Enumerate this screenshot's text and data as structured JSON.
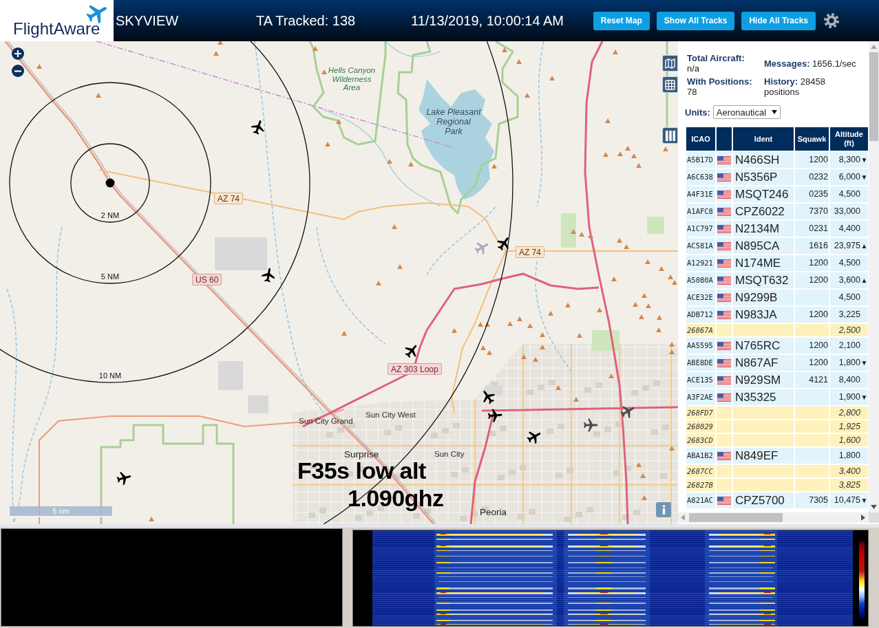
{
  "header": {
    "logo": "FlightAware",
    "title": "SKYVIEW",
    "tracked": "TA Tracked: 138",
    "datetime": "11/13/2019, 10:00:14 AM",
    "buttons": [
      "Reset Map",
      "Show All Tracks",
      "Hide All Tracks"
    ]
  },
  "map": {
    "areas": [
      {
        "kind": "wilderness",
        "lines": [
          "Hells Canyon",
          "Wilderness",
          "Area"
        ]
      },
      {
        "kind": "park",
        "lines": [
          "Lake Pleasant",
          "Regional",
          "Park"
        ]
      }
    ],
    "shields": [
      {
        "kind": "state",
        "text": "AZ 74"
      },
      {
        "kind": "state",
        "text": "AZ 74"
      },
      {
        "kind": "us",
        "text": "US 60"
      },
      {
        "kind": "us",
        "text": "AZ 303 Loop"
      }
    ],
    "places": [
      {
        "kind": "town",
        "text": "Sun City West"
      },
      {
        "kind": "town",
        "text": "Sun City Grand"
      },
      {
        "kind": "city",
        "text": "Surprise"
      },
      {
        "kind": "town",
        "text": "Sun City"
      },
      {
        "kind": "city",
        "text": "Peoria"
      }
    ],
    "range_rings": [
      "2 NM",
      "5 NM",
      "10 NM"
    ],
    "aircraft": [
      {
        "color": "#000000"
      },
      {
        "color": "#000000"
      },
      {
        "color": "#000000"
      },
      {
        "color": "#000000"
      },
      {
        "color": "#000000"
      },
      {
        "color": "#000000"
      },
      {
        "color": "#000000"
      },
      {
        "color": "#000000"
      },
      {
        "color": "#4a4a4a"
      },
      {
        "color": "#4a4a4a"
      },
      {
        "color": "#a8a8ba"
      }
    ],
    "annotation": [
      "F35s low alt",
      "1.090ghz"
    ],
    "scale": "5 nm"
  },
  "panel": {
    "stats": [
      "**Total Aircraft:** n/a",
      "**Messages:** 1656.1/sec",
      "**With Positions:** 78",
      "**History:** 28458 positions"
    ],
    "units": {
      "label": "Units:",
      "value": "Aeronautical"
    },
    "table": {
      "columns": [
        {
          "kind": "text",
          "label": "ICAO"
        },
        {
          "kind": "flag"
        },
        {
          "kind": "text",
          "label": "Ident"
        },
        {
          "kind": "text",
          "label": "Squawk"
        },
        {
          "kind": "text",
          "label": "Altitude (ft)"
        }
      ],
      "rows": [
        {
          "kind": "adsb",
          "icao": "A5B17D",
          "ident": "N466SH",
          "squawk": "1200",
          "altitude": "8,300",
          "trend": "▼"
        },
        {
          "kind": "adsb",
          "icao": "A6C638",
          "ident": "N5356P",
          "squawk": "0232",
          "altitude": "6,000",
          "trend": "▼"
        },
        {
          "kind": "adsb",
          "icao": "A4F31E",
          "ident": "MSQT246",
          "squawk": "0235",
          "altitude": "4,500"
        },
        {
          "kind": "adsb",
          "icao": "A1AFC8",
          "ident": "CPZ6022",
          "squawk": "7370",
          "altitude": "33,000"
        },
        {
          "kind": "adsb",
          "icao": "A1C797",
          "ident": "N2134M",
          "squawk": "0231",
          "altitude": "4,400"
        },
        {
          "kind": "adsb",
          "icao": "AC581A",
          "ident": "N895CA",
          "squawk": "1616",
          "altitude": "23,975",
          "trend": "▲"
        },
        {
          "kind": "adsb",
          "icao": "A12921",
          "ident": "N174ME",
          "squawk": "1200",
          "altitude": "4,500"
        },
        {
          "kind": "adsb",
          "icao": "A5080A",
          "ident": "MSQT632",
          "squawk": "1200",
          "altitude": "3,600",
          "trend": "▲"
        },
        {
          "kind": "adsb",
          "icao": "ACE32E",
          "ident": "N9299B",
          "altitude": "4,500"
        },
        {
          "kind": "adsb",
          "icao": "ADB712",
          "ident": "N983JA",
          "squawk": "1200",
          "altitude": "3,225"
        },
        {
          "kind": "tisb",
          "icao": "26867A",
          "altitude": "2,500"
        },
        {
          "kind": "adsb",
          "icao": "AA5595",
          "ident": "N765RC",
          "squawk": "1200",
          "altitude": "2,100"
        },
        {
          "kind": "adsb",
          "icao": "ABE8DE",
          "ident": "N867AF",
          "squawk": "1200",
          "altitude": "1,800",
          "trend": "▼"
        },
        {
          "kind": "adsb",
          "icao": "ACE135",
          "ident": "N929SM",
          "squawk": "4121",
          "altitude": "8,400"
        },
        {
          "kind": "adsb",
          "icao": "A3F2AE",
          "ident": "N35325",
          "altitude": "1,900",
          "trend": "▼"
        },
        {
          "kind": "tisb",
          "icao": "268FD7",
          "altitude": "2,800"
        },
        {
          "kind": "tisb",
          "icao": "268029",
          "altitude": "1,925"
        },
        {
          "kind": "tisb",
          "icao": "2683CD",
          "altitude": "1,600"
        },
        {
          "kind": "adsb",
          "icao": "ABA1B2",
          "ident": "N849EF",
          "altitude": "1,800"
        },
        {
          "kind": "tisb",
          "icao": "2687CC",
          "altitude": "3,400"
        },
        {
          "kind": "tisb",
          "icao": "26827B",
          "altitude": "3,825"
        },
        {
          "kind": "adsb",
          "icao": "A821AC",
          "ident": "CPZ5700",
          "squawk": "7305",
          "altitude": "10,475",
          "trend": "▼"
        }
      ]
    }
  }
}
